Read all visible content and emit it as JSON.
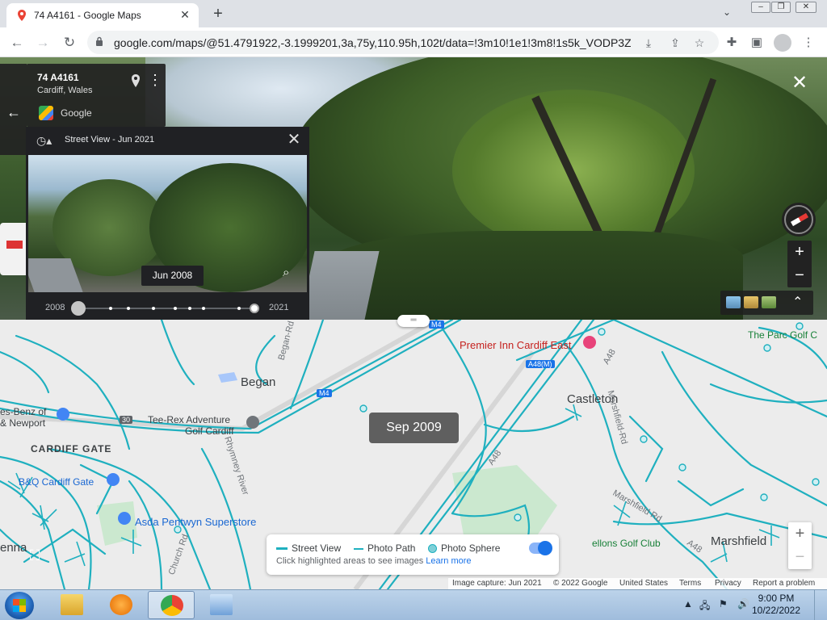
{
  "browser": {
    "tab_title": "74 A4161 - Google Maps",
    "tab_close": "✕",
    "new_tab": "+",
    "url": "google.com/maps/@51.4791922,-3.1999201,3a,75y,110.95h,102t/data=!3m10!1e1!3m8!1s5k_VODP3Z...",
    "icons": [
      "back-icon",
      "forward-icon",
      "reload-icon",
      "lock-icon",
      "install-icon",
      "share-icon",
      "bookmark-star-icon",
      "extensions-icon",
      "side-panel-icon",
      "profile-icon",
      "menu-icon"
    ]
  },
  "streetview": {
    "address_title": "74 A4161",
    "address_city": "Cardiff, Wales",
    "provider": "Google",
    "close": "✕"
  },
  "timetravel": {
    "header": "Street View - Jun 2021",
    "date_chip": "Jun 2008",
    "year_start": "2008",
    "year_end": "2021"
  },
  "map": {
    "date_bubble": "Sep 2009",
    "places": {
      "premier_inn": "Premier Inn Cardiff East",
      "parc_golf": "The Parc Golf C",
      "began": "Began",
      "castleton": "Castleton",
      "benz": "es-Benz of",
      "newport": "& Newport",
      "tee_rex_1": "Tee-Rex Adventure",
      "tee_rex_2": "Golf Cardiff",
      "cardiff_gate": "CARDIFF GATE",
      "bq": "B&Q Cardiff Gate",
      "asda": "Asda Pentwyn Superstore",
      "marshfield": "Marshfield",
      "pellons": "ellons Golf Club",
      "enna": "enna"
    },
    "roads": {
      "m4_a": "M4",
      "m4_b": "M4",
      "a48m": "A48(M)",
      "a48_a": "A48",
      "a48_b": "A48",
      "a48_c": "A48",
      "j30": "30",
      "began_rd": "Began-Rd",
      "rhymney": "Rhymney River",
      "marshfield_rd_a": "Marshfield-Rd",
      "marshfield_rd_b": "Marshfield Rd",
      "church_rd": "Church Rd",
      "pontprennau": "Pontprennau Link Rd"
    },
    "legend": {
      "street_view": "Street View",
      "photo_path": "Photo Path",
      "photo_sphere": "Photo Sphere",
      "hint": "Click highlighted areas to see images",
      "learn_more": "Learn more"
    },
    "attribution": {
      "capture": "Image capture: Jun 2021",
      "copyright": "© 2022 Google",
      "region": "United States",
      "terms": "Terms",
      "privacy": "Privacy",
      "report": "Report a problem"
    },
    "zoom_in": "+",
    "zoom_out": "−"
  },
  "taskbar": {
    "time": "9:00 PM",
    "date": "10/22/2022"
  },
  "colors": {
    "coverage_line": "#1fb0bf",
    "map_bg": "#ececec",
    "accent": "#1a73e8"
  }
}
